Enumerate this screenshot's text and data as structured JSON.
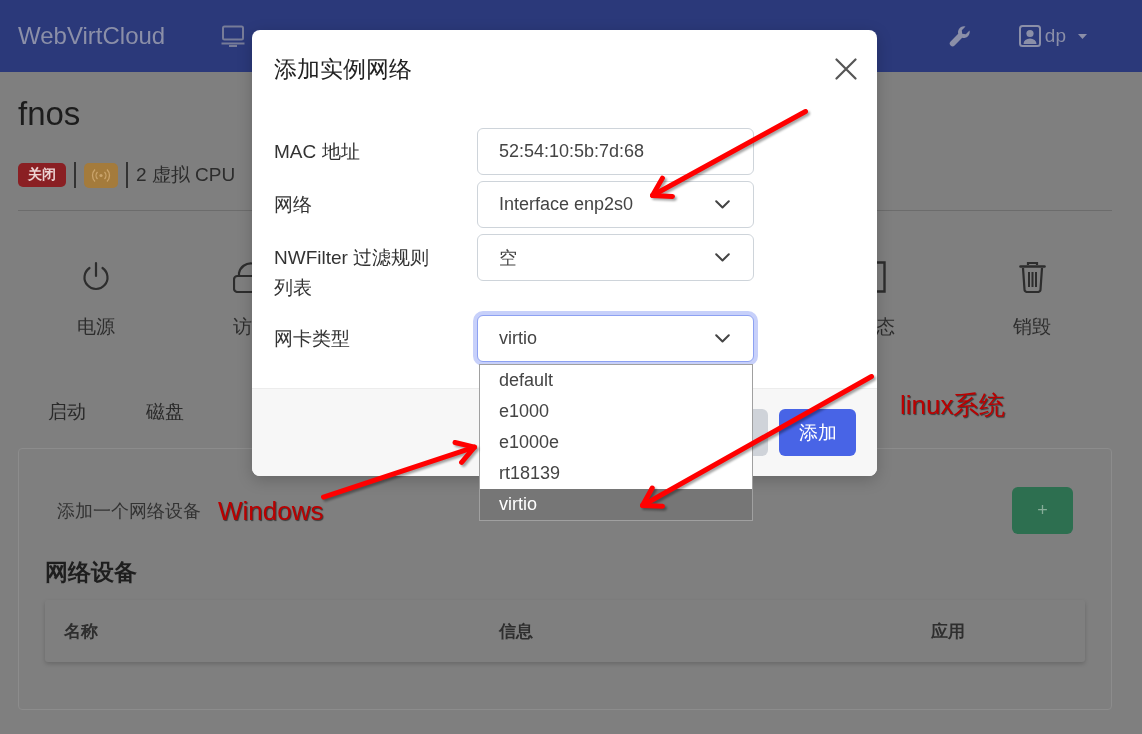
{
  "navbar": {
    "brand": "WebVirtCloud",
    "user": "dp"
  },
  "instance": {
    "name": "fnos",
    "status": "关闭",
    "cpu": "2 虚拟 CPU"
  },
  "actions": [
    {
      "label": "电源",
      "kind": "whole"
    },
    {
      "label": "访",
      "kind": "left-part"
    },
    {
      "label": "态",
      "kind": "right-part"
    },
    {
      "label": "销毁",
      "kind": "whole"
    }
  ],
  "tabs": [
    {
      "label": "启动",
      "selected": false
    },
    {
      "label": "磁盘",
      "selected": false
    }
  ],
  "network_panel": {
    "add_text": "添加一个网络设备",
    "add_button": "+",
    "title": "网络设备",
    "columns": [
      "名称",
      "信息",
      "应用"
    ]
  },
  "modal": {
    "title": "添加实例网络",
    "fields": [
      {
        "kind": "input",
        "label": "MAC 地址",
        "value": "52:54:10:5b:7d:68"
      },
      {
        "kind": "select",
        "label": "网络",
        "value": "Interface enp2s0",
        "focused": false
      },
      {
        "kind": "select",
        "label": "NWFilter 过滤规则列表",
        "value": "空",
        "focused": false
      },
      {
        "kind": "select",
        "label": "网卡类型",
        "value": "virtio",
        "focused": true,
        "options": [
          {
            "label": "default",
            "selected": false
          },
          {
            "label": "e1000",
            "selected": false
          },
          {
            "label": "e1000e",
            "selected": false
          },
          {
            "label": "rt18139",
            "selected": false
          },
          {
            "label": "virtio",
            "selected": true
          }
        ]
      }
    ],
    "submit": "添加"
  },
  "annotations": [
    {
      "text": "Windows"
    },
    {
      "text": "linux系统"
    }
  ]
}
